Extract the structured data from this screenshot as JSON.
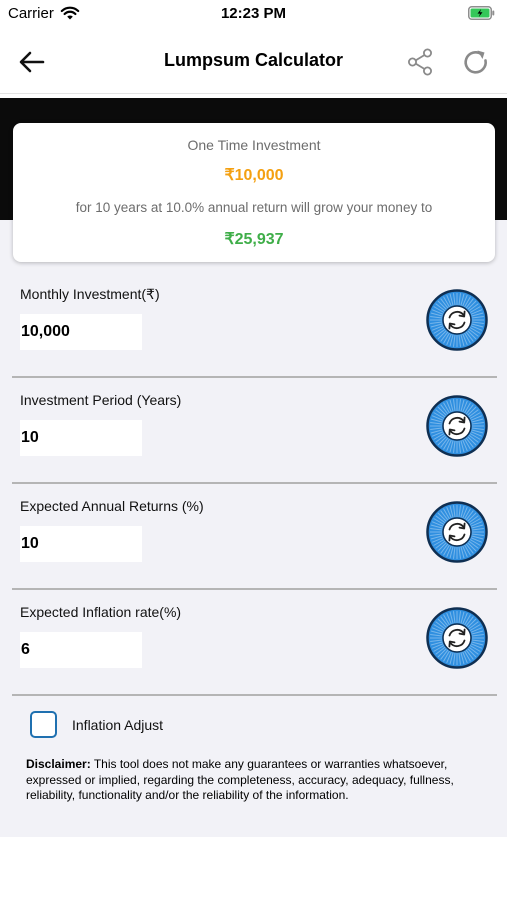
{
  "status_bar": {
    "carrier": "Carrier",
    "time": "12:23 PM"
  },
  "header": {
    "title": "Lumpsum Calculator"
  },
  "summary": {
    "label": "One Time Investment",
    "amount": "₹10,000",
    "description": "for 10 years at 10.0% annual return will grow your money to",
    "result": "₹25,937",
    "colors": {
      "amount": "#f4a011",
      "result": "#3fae49"
    }
  },
  "fields": [
    {
      "label": "Monthly Investment(₹)",
      "value": "10,000"
    },
    {
      "label": "Investment Period (Years)",
      "value": "10"
    },
    {
      "label": "Expected Annual Returns (%)",
      "value": "10"
    },
    {
      "label": "Expected Inflation rate(%)",
      "value": "6"
    }
  ],
  "inflation_adjust": {
    "label": "Inflation Adjust",
    "checked": false
  },
  "disclaimer": {
    "heading": "Disclaimer:",
    "text": " This tool does not make any guarantees or warranties whatsoever, expressed or implied, regarding the completeness, accuracy, adequacy, fullness, reliability, functionality and/or the reliability of the information."
  },
  "icons": [
    "wifi-icon",
    "battery-icon",
    "back-arrow-icon",
    "share-icon",
    "refresh-icon",
    "reset-dial-icon"
  ],
  "accent_color": "#2f8fe0"
}
